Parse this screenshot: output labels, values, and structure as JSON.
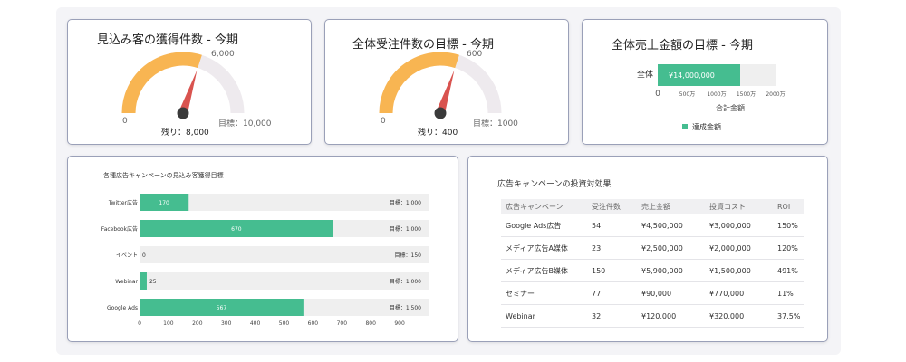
{
  "gauges": [
    {
      "title": "見込み客の獲得件数 - 今期",
      "min_label": "0",
      "target_label": "目標：10,000",
      "value_label": "6,000",
      "remaining_label": "残り：8,000",
      "value": 6000,
      "max": 10000
    },
    {
      "title": "全体受注件数の目標 - 今期",
      "min_label": "0",
      "target_label": "目標：1000",
      "value_label": "600",
      "remaining_label": "残り：400",
      "value": 600,
      "max": 1000
    }
  ],
  "revenue_card": {
    "title": "全体売上金額の目標 - 今期",
    "chart_data": {
      "type": "bar",
      "orientation": "horizontal",
      "categories": [
        "全体"
      ],
      "values": [
        14000000
      ],
      "data_label": "¥14,000,000",
      "target_max": 20000000,
      "x_ticks": [
        "0",
        "500万",
        "1000万",
        "1500万",
        "2000万"
      ],
      "xlim": [
        0,
        20000000
      ],
      "xlabel": "合計金額",
      "legend": "達成金額",
      "bar_color": "#45bd90"
    }
  },
  "campaign_card": {
    "title": "各種広告キャンペーンの見込み客獲得目標",
    "chart_data": {
      "type": "bar",
      "orientation": "horizontal",
      "categories": [
        "Twitter広告",
        "Facebook広告",
        "イベント",
        "Webinar",
        "Google Ads"
      ],
      "values": [
        170,
        670,
        0,
        25,
        567
      ],
      "value_labels": [
        "170",
        "670",
        "0",
        "25",
        "567"
      ],
      "targets": [
        1000,
        1000,
        150,
        1000,
        1500
      ],
      "target_labels": [
        "目標：1,000",
        "目標：1,000",
        "目標：150",
        "目標：1,000",
        "目標：1,500"
      ],
      "x_ticks": [
        "0",
        "100",
        "200",
        "300",
        "400",
        "500",
        "600",
        "700",
        "800",
        "900"
      ],
      "xlim": [
        0,
        1000
      ],
      "bar_color": "#45bd90"
    }
  },
  "roi_card": {
    "title": "広告キャンペーンの投資対効果",
    "columns": [
      "広告キャンペーン",
      "受注件数",
      "売上金額",
      "投資コスト",
      "ROI"
    ],
    "rows": [
      {
        "campaign": "Google Ads広告",
        "orders": "54",
        "revenue": "¥4,500,000",
        "cost": "¥3,000,000",
        "roi": "150%",
        "roi_positive": true
      },
      {
        "campaign": "メディア広告A媒体",
        "orders": "23",
        "revenue": "¥2,500,000",
        "cost": "¥2,000,000",
        "roi": "120%",
        "roi_positive": true
      },
      {
        "campaign": "メディア広告B媒体",
        "orders": "150",
        "revenue": "¥5,900,000",
        "cost": "¥1,500,000",
        "roi": "491%",
        "roi_positive": true
      },
      {
        "campaign": "セミナー",
        "orders": "77",
        "revenue": "¥90,000",
        "cost": "¥770,000",
        "roi": "11%",
        "roi_positive": false
      },
      {
        "campaign": "Webinar",
        "orders": "32",
        "revenue": "¥120,000",
        "cost": "¥320,000",
        "roi": "37.5%",
        "roi_positive": false
      }
    ]
  },
  "colors": {
    "gauge_fill": "#f8b552",
    "gauge_track": "#eeeaee",
    "needle": "#d9534f",
    "hub": "#3a3a3a",
    "bar": "#45bd90",
    "bar_track": "#efefef",
    "roi_positive": "#1aa058",
    "roi_negative": "#d93a3a"
  }
}
